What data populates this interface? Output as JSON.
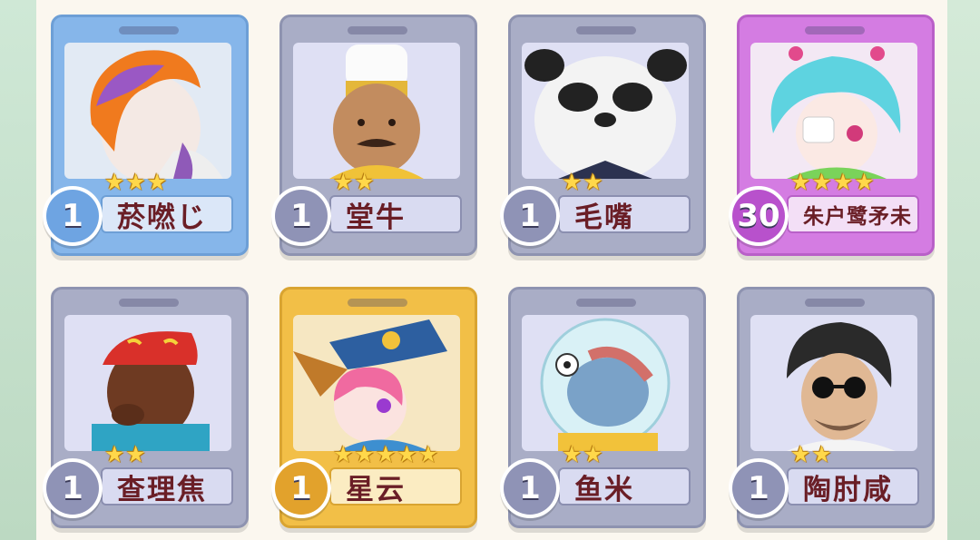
{
  "accent_colors": {
    "gray": "#a9adc6",
    "blue": "#86b6ea",
    "purple": "#d47ce2",
    "gold": "#f2bf47"
  },
  "cards": [
    {
      "name": "菸嘫じ",
      "level": "1",
      "stars": 3,
      "frame": "blue"
    },
    {
      "name": "堂牛",
      "level": "1",
      "stars": 2,
      "frame": "gray"
    },
    {
      "name": "毛嘴",
      "level": "1",
      "stars": 2,
      "frame": "gray"
    },
    {
      "name": "朱户鹭矛未",
      "level": "30",
      "stars": 4,
      "frame": "purple"
    },
    {
      "name": "查理焦",
      "level": "1",
      "stars": 2,
      "frame": "gray"
    },
    {
      "name": "星云",
      "level": "1",
      "stars": 5,
      "frame": "gold"
    },
    {
      "name": "鱼米",
      "level": "1",
      "stars": 2,
      "frame": "gray"
    },
    {
      "name": "陶肘咸",
      "level": "1",
      "stars": 2,
      "frame": "gray"
    }
  ]
}
